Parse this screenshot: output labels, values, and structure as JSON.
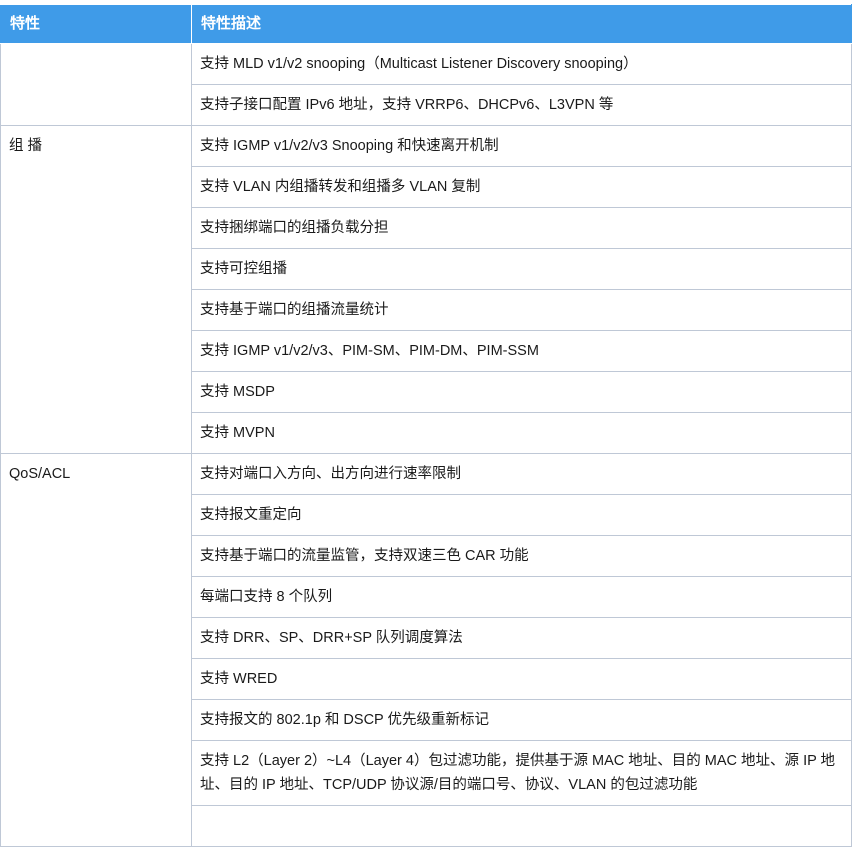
{
  "header": {
    "feature": "特性",
    "description": "特性描述"
  },
  "groups": [
    {
      "feature": "",
      "items": [
        "支持 MLD v1/v2 snooping（Multicast Listener Discovery snooping）",
        "支持子接口配置 IPv6 地址，支持 VRRP6、DHCPv6、L3VPN 等"
      ]
    },
    {
      "feature": "组 播",
      "items": [
        "支持 IGMP v1/v2/v3 Snooping 和快速离开机制",
        "支持 VLAN 内组播转发和组播多 VLAN 复制",
        "支持捆绑端口的组播负载分担",
        "支持可控组播",
        "支持基于端口的组播流量统计",
        "支持 IGMP v1/v2/v3、PIM-SM、PIM-DM、PIM-SSM",
        "支持 MSDP",
        "支持 MVPN"
      ]
    },
    {
      "feature": "QoS/ACL",
      "items": [
        "支持对端口入方向、出方向进行速率限制",
        "支持报文重定向",
        "支持基于端口的流量监管，支持双速三色 CAR 功能",
        "每端口支持 8 个队列",
        "支持 DRR、SP、DRR+SP 队列调度算法",
        "支持 WRED",
        "支持报文的 802.1p 和 DSCP 优先级重新标记",
        "支持 L2（Layer 2）~L4（Layer 4）包过滤功能，提供基于源 MAC 地址、目的 MAC 地址、源 IP 地址、目的 IP 地址、TCP/UDP 协议源/目的端口号、协议、VLAN 的包过滤功能",
        ""
      ]
    }
  ]
}
